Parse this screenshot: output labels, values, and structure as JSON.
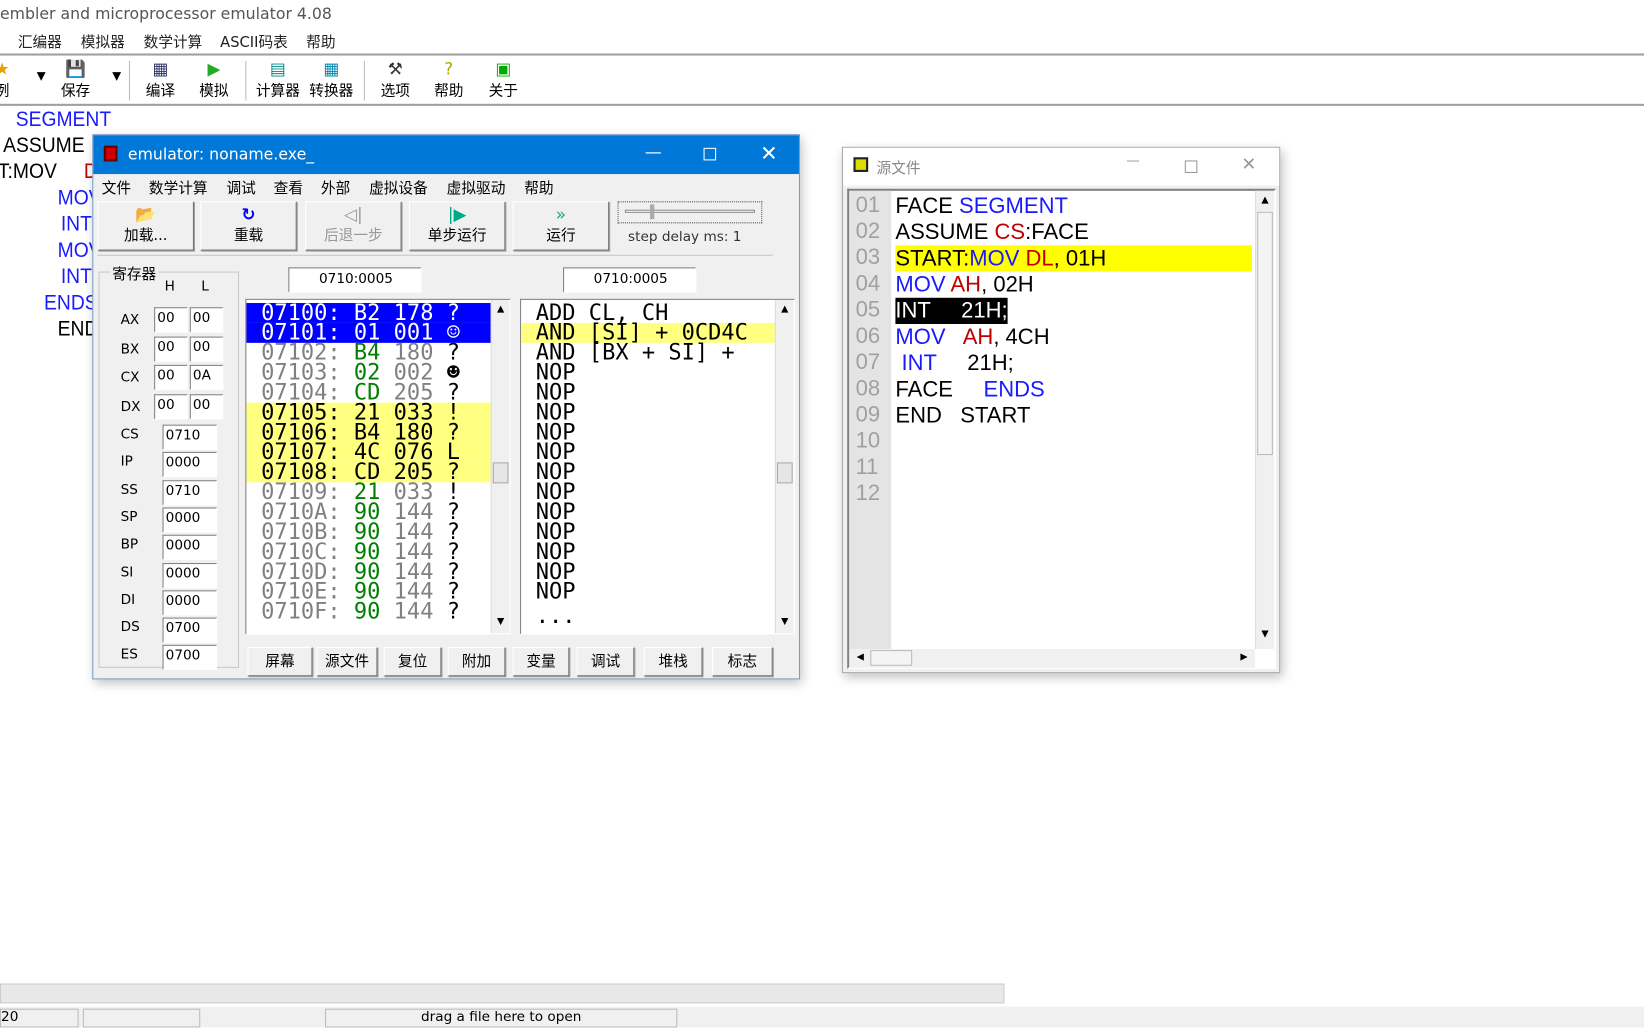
{
  "app": {
    "title": "embler and microprocessor emulator 4.08",
    "menu": [
      "汇编器",
      "模拟器",
      "数学计算",
      "ASCII码表",
      "帮助"
    ],
    "toolbar": [
      {
        "label": "例",
        "icon": "star-icon"
      },
      {
        "label": "保存",
        "icon": "save-icon"
      },
      {
        "label": "编译",
        "icon": "compile-icon"
      },
      {
        "label": "模拟",
        "icon": "play-icon"
      },
      {
        "label": "计算器",
        "icon": "calculator-icon"
      },
      {
        "label": "转换器",
        "icon": "converter-icon"
      },
      {
        "label": "选项",
        "icon": "tools-icon"
      },
      {
        "label": "帮助",
        "icon": "help-icon"
      },
      {
        "label": "关于",
        "icon": "chip-icon"
      }
    ],
    "background_code": [
      "SEGMENT",
      "ASSUME",
      "T:MOV",
      "D",
      "MOV",
      "INT",
      "MOV",
      "INT",
      "ENDS",
      "END"
    ],
    "status": {
      "line": "20",
      "hint": "drag a file here to open"
    }
  },
  "emulator": {
    "title": "emulator: noname.exe_",
    "menu": [
      "文件",
      "数学计算",
      "调试",
      "查看",
      "外部",
      "虚拟设备",
      "虚拟驱动",
      "帮助"
    ],
    "buttons": {
      "load": "加载...",
      "reload": "重载",
      "back": "后退一步",
      "step": "单步运行",
      "run": "运行"
    },
    "step_delay": "step delay ms: 1",
    "step_delay_value": 1,
    "registers_title": "寄存器",
    "h": "H",
    "l": "L",
    "gp": [
      {
        "name": "AX",
        "h": "00",
        "l": "00"
      },
      {
        "name": "BX",
        "h": "00",
        "l": "00"
      },
      {
        "name": "CX",
        "h": "00",
        "l": "0A"
      },
      {
        "name": "DX",
        "h": "00",
        "l": "00"
      }
    ],
    "seg": [
      {
        "name": "CS",
        "v": "0710"
      },
      {
        "name": "IP",
        "v": "0000"
      },
      {
        "name": "SS",
        "v": "0710"
      },
      {
        "name": "SP",
        "v": "0000"
      },
      {
        "name": "BP",
        "v": "0000"
      },
      {
        "name": "SI",
        "v": "0000"
      },
      {
        "name": "DI",
        "v": "0000"
      },
      {
        "name": "DS",
        "v": "0700"
      },
      {
        "name": "ES",
        "v": "0700"
      }
    ],
    "mem_addr": "0710:0005",
    "dis_addr": "0710:0005",
    "memory": [
      {
        "a": "07100:",
        "h": "B2",
        "d": "178",
        "c": "?",
        "s": "sel"
      },
      {
        "a": "07101:",
        "h": "01",
        "d": "001",
        "c": "☺",
        "s": "sel"
      },
      {
        "a": "07102:",
        "h": "B4",
        "d": "180",
        "c": "?",
        "s": ""
      },
      {
        "a": "07103:",
        "h": "02",
        "d": "002",
        "c": "☻",
        "s": ""
      },
      {
        "a": "07104:",
        "h": "CD",
        "d": "205",
        "c": "?",
        "s": ""
      },
      {
        "a": "07105:",
        "h": "21",
        "d": "033",
        "c": "!",
        "s": "hl"
      },
      {
        "a": "07106:",
        "h": "B4",
        "d": "180",
        "c": "?",
        "s": "hl"
      },
      {
        "a": "07107:",
        "h": "4C",
        "d": "076",
        "c": "L",
        "s": "hl"
      },
      {
        "a": "07108:",
        "h": "CD",
        "d": "205",
        "c": "?",
        "s": "hl"
      },
      {
        "a": "07109:",
        "h": "21",
        "d": "033",
        "c": "!",
        "s": ""
      },
      {
        "a": "0710A:",
        "h": "90",
        "d": "144",
        "c": "?",
        "s": ""
      },
      {
        "a": "0710B:",
        "h": "90",
        "d": "144",
        "c": "?",
        "s": ""
      },
      {
        "a": "0710C:",
        "h": "90",
        "d": "144",
        "c": "?",
        "s": ""
      },
      {
        "a": "0710D:",
        "h": "90",
        "d": "144",
        "c": "?",
        "s": ""
      },
      {
        "a": "0710E:",
        "h": "90",
        "d": "144",
        "c": "?",
        "s": ""
      },
      {
        "a": "0710F:",
        "h": "90",
        "d": "144",
        "c": "?",
        "s": ""
      }
    ],
    "disasm": [
      "ADD CL, CH",
      "AND [SI] + 0CD4C",
      "AND [BX + SI] +",
      "NOP",
      "NOP",
      "NOP",
      "NOP",
      "NOP",
      "NOP",
      "NOP",
      "NOP",
      "NOP",
      "NOP",
      "NOP",
      "NOP",
      "..."
    ],
    "disasm_highlight": 1,
    "bottom_buttons": [
      "屏幕",
      "源文件",
      "复位",
      "附加",
      "变量",
      "调试",
      "堆栈",
      "标志"
    ]
  },
  "source": {
    "title": "源文件",
    "lines": [
      [
        {
          "t": "FACE ",
          "c": ""
        },
        {
          "t": "SEGMENT",
          "c": "bl"
        }
      ],
      [
        {
          "t": "ASSUME ",
          "c": ""
        },
        {
          "t": "CS",
          "c": "rd"
        },
        {
          "t": ":FACE",
          "c": ""
        }
      ],
      [
        {
          "t": "START:",
          "c": ""
        },
        {
          "t": "MOV ",
          "c": "bl"
        },
        {
          "t": "DL",
          "c": "rd"
        },
        {
          "t": ", 01H",
          "c": ""
        }
      ],
      [
        {
          "t": "MOV ",
          "c": "bl"
        },
        {
          "t": "AH",
          "c": "rd"
        },
        {
          "t": ", 02H",
          "c": ""
        }
      ],
      [
        {
          "t": "INT     21H;",
          "c": ""
        }
      ],
      [
        {
          "t": "MOV   ",
          "c": "bl"
        },
        {
          "t": "AH",
          "c": "rd"
        },
        {
          "t": ", 4CH",
          "c": ""
        }
      ],
      [
        {
          "t": " INT",
          "c": "bl"
        },
        {
          "t": "     21H;",
          "c": ""
        }
      ],
      [
        {
          "t": "FACE     ",
          "c": ""
        },
        {
          "t": "ENDS",
          "c": "bl"
        }
      ],
      [
        {
          "t": "END   START",
          "c": ""
        }
      ],
      [],
      [],
      []
    ],
    "line_numbers": [
      "01",
      "02",
      "03",
      "04",
      "05",
      "06",
      "07",
      "08",
      "09",
      "10",
      "11",
      "12"
    ],
    "current_line": 3,
    "selected_line": 5
  },
  "colors": {
    "titlebar": "#0078d7",
    "selection": "#0000ff",
    "highlight": "#ffff80",
    "current": "#ffff00",
    "keyword": "#1a1aff",
    "register": "#c00000",
    "hex": "#008000",
    "addr": "#808080"
  }
}
